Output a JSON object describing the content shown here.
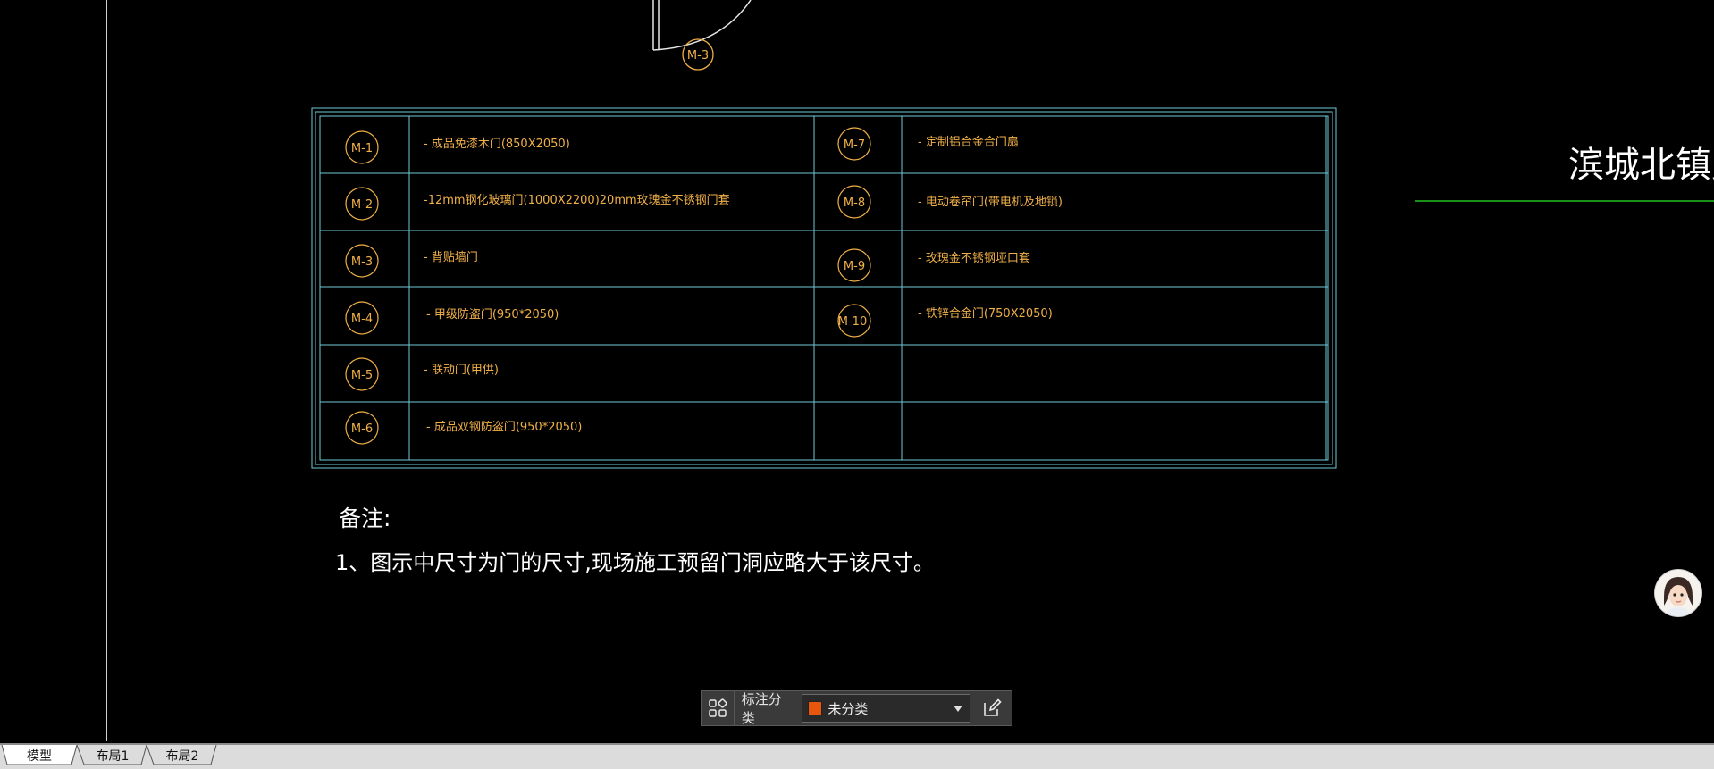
{
  "canvas": {
    "top_door_tag": "M-3",
    "right_title": "滨城北镇支",
    "schedule": {
      "rows": [
        {
          "left_tag": "M-1",
          "left_desc": "- 成品免漆木门(850X2050)",
          "right_tag": "M-7",
          "right_desc": "- 定制铝合金合门扇"
        },
        {
          "left_tag": "M-2",
          "left_desc": "-12mm钢化玻璃门(1000X2200)20mm玫瑰金不锈钢门套",
          "right_tag": "M-8",
          "right_desc": "- 电动卷帘门(带电机及地锁)"
        },
        {
          "left_tag": "M-3",
          "left_desc": "- 背贴墙门",
          "right_tag": "M-9",
          "right_desc": "- 玫瑰金不锈钢垭口套"
        },
        {
          "left_tag": "M-4",
          "left_desc": "- 甲级防盗门(950*2050)",
          "right_tag": "M-10",
          "right_desc": "- 铁锌合金门(750X2050)"
        },
        {
          "left_tag": "M-5",
          "left_desc": "- 联动门(甲供)",
          "right_tag": "",
          "right_desc": ""
        },
        {
          "left_tag": "M-6",
          "left_desc": "- 成品双钢防盗门(950*2050)",
          "right_tag": "",
          "right_desc": ""
        }
      ]
    },
    "notes_title": "备注:",
    "notes_line1": "1、图示中尺寸为门的尺寸,现场施工预留门洞应略大于该尺寸。"
  },
  "toolbar": {
    "label": "标注分类",
    "select_value": "未分类",
    "select_color": "#e8550c",
    "grid_icon": "grid-icon",
    "edit_icon": "edit-icon"
  },
  "tabs": [
    "模型",
    "布局1",
    "布局2"
  ],
  "colors": {
    "background": "#000000",
    "table_line": "#6fc7d6",
    "annotation_text": "#f0b048",
    "white_text": "#ffffff",
    "green_line": "#22c322"
  }
}
